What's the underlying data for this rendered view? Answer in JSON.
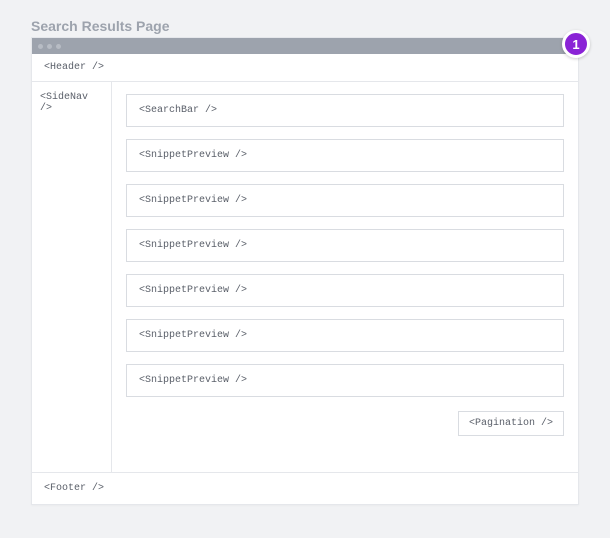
{
  "title": "Search Results Page",
  "badge": "1",
  "header": "<Header />",
  "sidenav": "<SideNav />",
  "searchbar": "<SearchBar />",
  "snippets": [
    "<SnippetPreview />",
    "<SnippetPreview />",
    "<SnippetPreview />",
    "<SnippetPreview />",
    "<SnippetPreview />",
    "<SnippetPreview />"
  ],
  "pagination": "<Pagination />",
  "footer": "<Footer />"
}
